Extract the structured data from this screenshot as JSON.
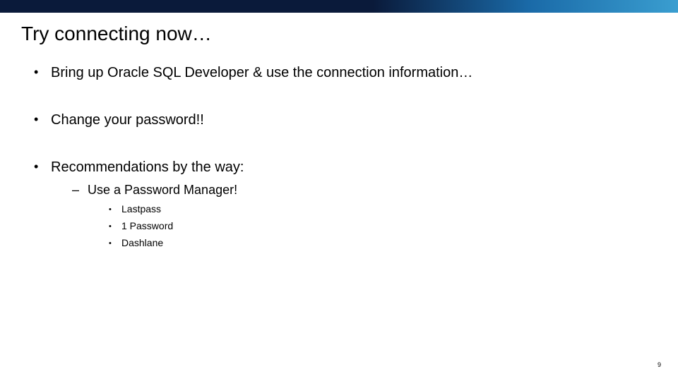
{
  "title": "Try connecting now…",
  "bullets": {
    "level1": [
      "Bring up Oracle SQL Developer & use the connection information…",
      "Change your password!!",
      "Recommendations by the way:"
    ],
    "level2": [
      "Use a Password Manager!"
    ],
    "level3": [
      "Lastpass",
      "1 Password",
      "Dashlane"
    ]
  },
  "page_number": "9"
}
